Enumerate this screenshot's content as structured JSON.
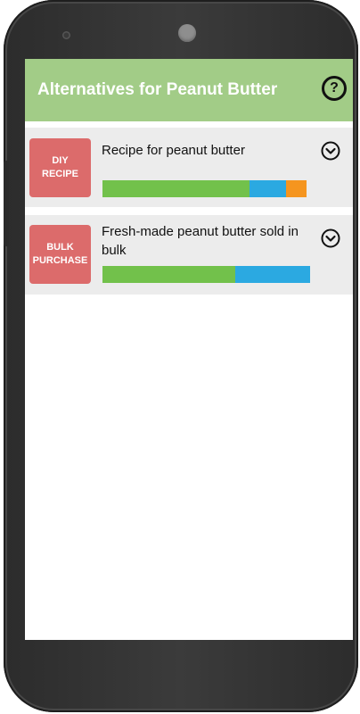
{
  "header": {
    "title": "Alternatives for Peanut Butter",
    "help_label": "?"
  },
  "colors": {
    "header_bg": "#a2cc87",
    "tag_bg": "#dc6b6b",
    "card_bg": "#ececec",
    "bar_green": "#72c14b",
    "bar_blue": "#2ba9e1",
    "bar_orange": "#f5951f"
  },
  "cards": [
    {
      "tag_line1": "DIY",
      "tag_line2": "RECIPE",
      "title": "Recipe for peanut butter",
      "expand_icon": "chevron-down-circle-icon",
      "bar": [
        {
          "color": "#72c14b",
          "fraction": 0.72
        },
        {
          "color": "#2ba9e1",
          "fraction": 0.18
        },
        {
          "color": "#f5951f",
          "fraction": 0.1
        }
      ]
    },
    {
      "tag_line1": "BULK",
      "tag_line2": "PURCHASE",
      "title": "Fresh-made peanut butter sold in bulk",
      "expand_icon": "chevron-down-circle-icon",
      "bar": [
        {
          "color": "#72c14b",
          "fraction": 0.639
        },
        {
          "color": "#2ba9e1",
          "fraction": 0.361
        }
      ]
    }
  ]
}
